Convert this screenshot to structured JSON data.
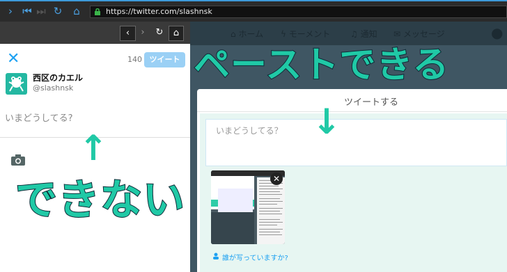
{
  "browser": {
    "url": "https://twitter.com/slashnsk",
    "nav_icons": [
      "forward-icon",
      "first-icon",
      "last-icon",
      "reload-icon",
      "home-icon"
    ]
  },
  "left_panel": {
    "toolbar_icons": [
      "back-icon",
      "forward-icon",
      "reload-icon",
      "home-icon"
    ],
    "char_count": "140",
    "tweet_button": "ツイート",
    "user_name": "西区のカエル",
    "user_handle": "@slashnsk",
    "placeholder": "いまどうしてる?"
  },
  "right_panel": {
    "nav": [
      "ホーム",
      "モーメント",
      "通知",
      "メッセージ"
    ],
    "modal_title": "ツイートする",
    "placeholder": "いまどうしてる？",
    "tag_people": "誰が写っていますか?"
  },
  "overlay": {
    "paste_label": "ペーストできる",
    "cannot_label": "できない",
    "arrow_down": "↓",
    "arrow_up": "↑"
  },
  "colors": {
    "accent": "#20c9a6",
    "twitter_blue": "#1da1f2"
  }
}
